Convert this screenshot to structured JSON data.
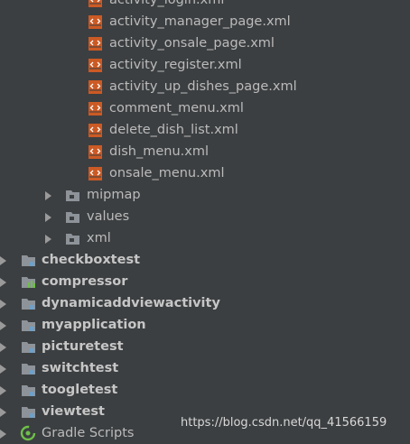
{
  "tree": {
    "layout_files": [
      "activity_login.xml",
      "activity_manager_page.xml",
      "activity_onsale_page.xml",
      "activity_register.xml",
      "activity_up_dishes_page.xml",
      "comment_menu.xml",
      "delete_dish_list.xml",
      "dish_menu.xml",
      "onsale_menu.xml"
    ],
    "res_folders": [
      "mipmap",
      "values",
      "xml"
    ],
    "modules": [
      "checkboxtest",
      "compressor",
      "dynamicaddviewactivity",
      "myapplication",
      "picturetest",
      "switchtest",
      "toogletest",
      "viewtest"
    ],
    "gradle_scripts": "Gradle Scripts"
  },
  "watermark": "https://blog.csdn.net/qq_41566159",
  "colors": {
    "background": "#3c3f41",
    "text": "#bbbbbb",
    "xml_icon": "#cc5a24",
    "folder_icon": "#8d9399",
    "gradle_icon": "#6fbf4a"
  }
}
